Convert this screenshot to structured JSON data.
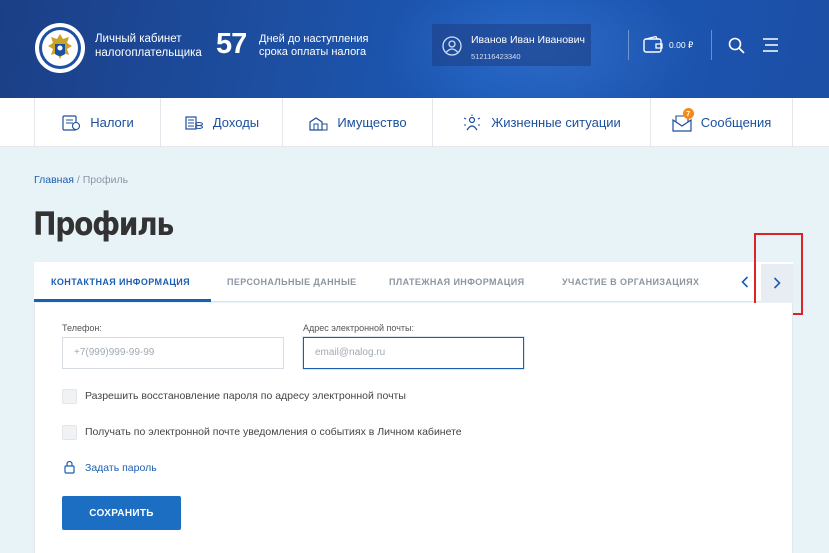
{
  "header": {
    "app_title_line1": "Личный кабинет",
    "app_title_line2": "налогоплательщика",
    "days_count": "57",
    "days_text_line1": "Дней до наступления",
    "days_text_line2": "срока оплаты налога",
    "user_name": "Иванов Иван Иванович",
    "user_inn": "512116423340",
    "balance": "0.00 ₽",
    "icons": [
      "emblem-logo",
      "user-icon",
      "wallet-icon",
      "search-icon",
      "menu-icon"
    ]
  },
  "nav": {
    "items": [
      {
        "label": "Налоги",
        "icon": "taxes-icon"
      },
      {
        "label": "Доходы",
        "icon": "income-icon"
      },
      {
        "label": "Имущество",
        "icon": "property-icon"
      },
      {
        "label": "Жизненные ситуации",
        "icon": "life-situations-icon"
      },
      {
        "label": "Сообщения",
        "icon": "messages-icon",
        "badge": "7"
      }
    ]
  },
  "breadcrumb": {
    "home": "Главная",
    "separator": " / ",
    "current": "Профиль"
  },
  "page_title": "Профиль",
  "tabs": [
    {
      "label": "КОНТАКТНАЯ ИНФОРМАЦИЯ",
      "active": true
    },
    {
      "label": "ПЕРСОНАЛЬНЫЕ ДАННЫЕ",
      "active": false
    },
    {
      "label": "ПЛАТЕЖНАЯ ИНФОРМАЦИЯ",
      "active": false
    },
    {
      "label": "УЧАСТИЕ В ОРГАНИЗАЦИЯХ",
      "active": false
    }
  ],
  "form": {
    "phone_label": "Телефон:",
    "phone_placeholder": "+7(999)999-99-99",
    "email_label": "Адрес электронной почты:",
    "email_placeholder": "email@nalog.ru",
    "checkbox_1": "Разрешить восстановление пароля по адресу электронной почты",
    "checkbox_2": "Получать по электронной почте уведомления о событиях в Личном кабинете",
    "set_password": "Задать пароль",
    "save_button": "СОХРАНИТЬ"
  },
  "colors": {
    "header_blue": "#1d4fa2",
    "accent": "#1b5eb3",
    "button": "#1b6ec2",
    "badge": "#f08b1c",
    "highlight": "#d9252a"
  }
}
